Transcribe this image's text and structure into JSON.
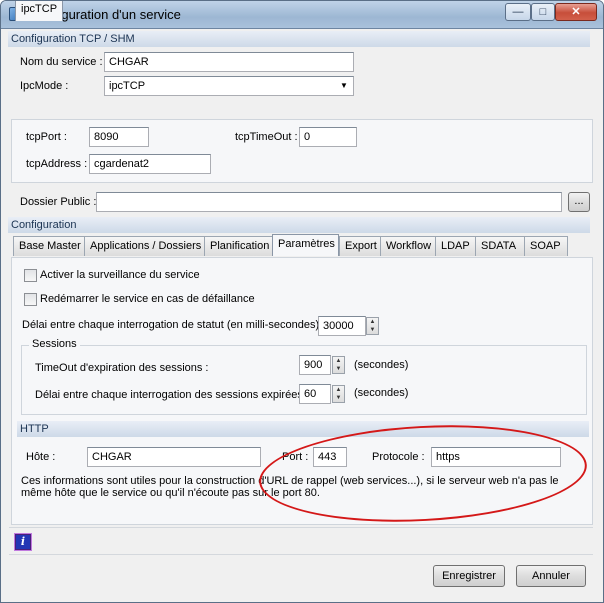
{
  "window": {
    "title": "Configuration d'un service",
    "controls": {
      "minimize": "—",
      "maximize": "□",
      "close": "✕"
    }
  },
  "tcp_section": {
    "header": "Configuration TCP / SHM",
    "nom_label": "Nom du service :",
    "nom_value": "CHGAR",
    "ipcmode_label": "IpcMode :",
    "ipcmode_value": "ipcTCP",
    "ipctcp_tab": "ipcTCP",
    "tcpport_label": "tcpPort :",
    "tcpport_value": "8090",
    "tcptimeout_label": "tcpTimeOut :",
    "tcptimeout_value": "0",
    "tcpaddress_label": "tcpAddress :",
    "tcpaddress_value": "cgardenat2",
    "dossier_label": "Dossier Public :",
    "dossier_value": "",
    "browse_label": "..."
  },
  "config_section": {
    "header": "Configuration",
    "tabs": [
      "Base Master",
      "Applications / Dossiers",
      "Planification",
      "Paramètres",
      "Export",
      "Workflow",
      "LDAP",
      "SDATA",
      "SOAP"
    ],
    "active_tab": "Paramètres"
  },
  "parametres": {
    "check1_label": "Activer la surveillance du service",
    "check2_label": "Redémarrer le service en cas de défaillance",
    "delai_label": "Délai entre chaque interrogation de statut (en milli-secondes) :",
    "delai_value": "30000",
    "sessions_header": "Sessions",
    "timeout_label": "TimeOut d'expiration des sessions   :",
    "timeout_value": "900",
    "timeout_unit": "(secondes)",
    "delai_sessions_label": "Délai entre chaque interrogation des sessions expirées :",
    "delai_sessions_value": "60",
    "delai_sessions_unit": "(secondes)"
  },
  "http": {
    "header": "HTTP",
    "hote_label": "Hôte :",
    "hote_value": "CHGAR",
    "port_label": "Port :",
    "port_value": "443",
    "protocole_label": "Protocole :",
    "protocole_value": "https",
    "note_line1": "Ces informations sont utiles pour la construction d'URL de rappel (web services...), si le serveur web n'a pas le",
    "note_line2": "même hôte que le service ou qu'il n'écoute pas sur le port 80."
  },
  "footer": {
    "save_label": "Enregistrer",
    "cancel_label": "Annuler"
  }
}
